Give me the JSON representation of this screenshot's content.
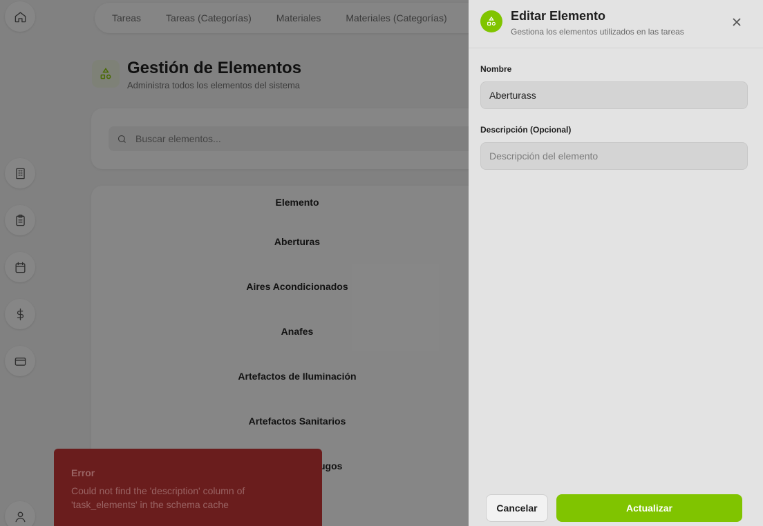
{
  "sidebar": {
    "items": [
      {
        "icon": "home-icon"
      },
      {
        "icon": "building-icon"
      },
      {
        "icon": "clipboard-icon"
      },
      {
        "icon": "calendar-icon"
      },
      {
        "icon": "dollar-icon"
      },
      {
        "icon": "credit-card-icon"
      },
      {
        "icon": "user-icon"
      }
    ]
  },
  "topnav": {
    "tabs": [
      "Tareas",
      "Tareas (Categorías)",
      "Materiales",
      "Materiales (Categorías)"
    ]
  },
  "page": {
    "title": "Gestión de Elementos",
    "subtitle": "Administra todos los elementos del sistema"
  },
  "search": {
    "placeholder": "Buscar elementos..."
  },
  "table": {
    "header": "Elemento",
    "rows": [
      "Aberturas",
      "Aires Acondicionados",
      "Anafes",
      "Artefactos de Iluminación",
      "Artefactos Sanitarios",
      "ugos"
    ]
  },
  "toast": {
    "title": "Error",
    "message": "Could not find the 'description' column of 'task_elements' in the schema cache"
  },
  "drawer": {
    "title": "Editar Elemento",
    "subtitle": "Gestiona los elementos utilizados en las tareas",
    "name_label": "Nombre",
    "name_value": "Aberturass",
    "description_label": "Descripción (Opcional)",
    "description_placeholder": "Descripción del elemento",
    "cancel_label": "Cancelar",
    "update_label": "Actualizar"
  },
  "colors": {
    "accent": "#80c400",
    "toast_bg": "#6a1d1d",
    "drawer_bg": "#e3e3e3"
  }
}
